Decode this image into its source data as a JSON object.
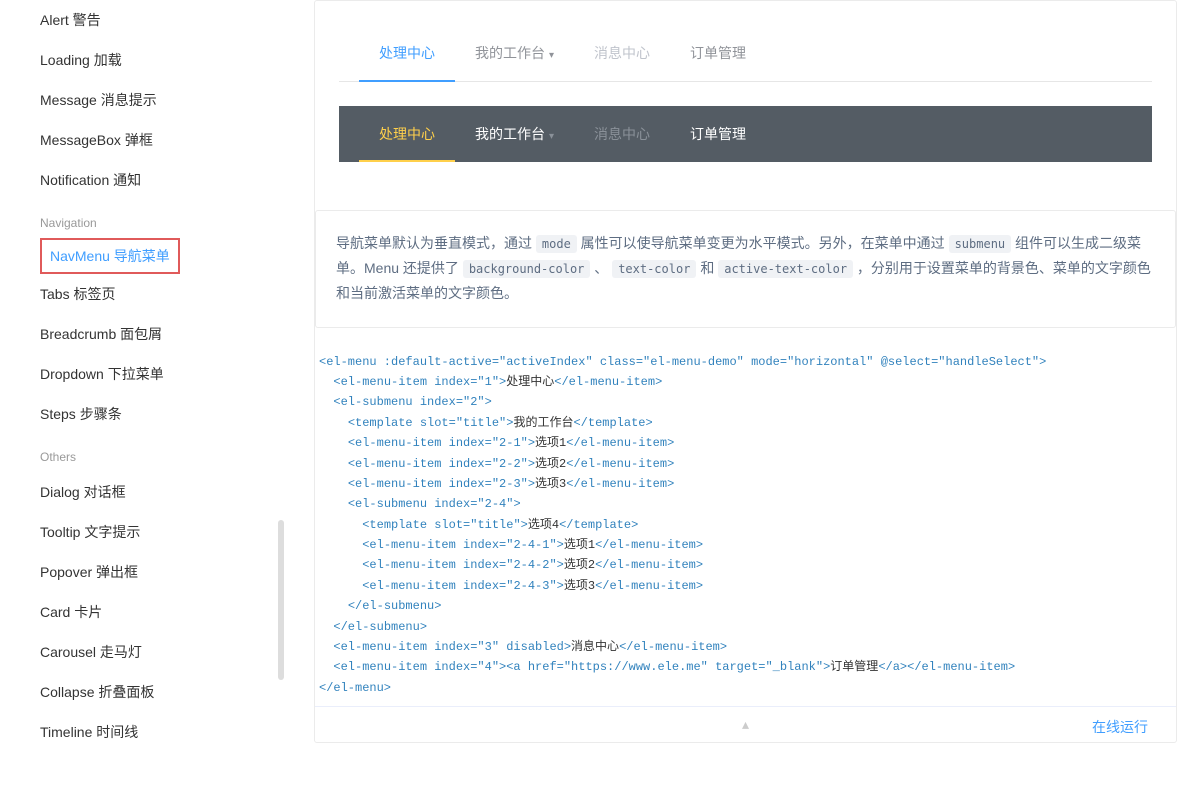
{
  "sidebar": {
    "items1": [
      "Alert 警告",
      "Loading 加载",
      "Message 消息提示",
      "MessageBox 弹框",
      "Notification 通知"
    ],
    "group_nav": "Navigation",
    "items2": [
      "NavMenu 导航菜单",
      "Tabs 标签页",
      "Breadcrumb 面包屑",
      "Dropdown 下拉菜单",
      "Steps 步骤条"
    ],
    "group_others": "Others",
    "items3": [
      "Dialog 对话框",
      "Tooltip 文字提示",
      "Popover 弹出框",
      "Card 卡片",
      "Carousel 走马灯",
      "Collapse 折叠面板",
      "Timeline 时间线"
    ]
  },
  "menu_demo": {
    "item1": "处理中心",
    "item2": "我的工作台",
    "item3": "消息中心",
    "item4": "订单管理"
  },
  "description": {
    "p1a": "导航菜单默认为垂直模式，通过 ",
    "c1": "mode",
    "p1b": " 属性可以使导航菜单变更为水平模式。另外，在菜单中通过 ",
    "c2": "submenu",
    "p1c": " 组件可以生成二级菜单。Menu 还提供了 ",
    "c3": "background-color",
    "sep1": " 、 ",
    "c4": "text-color",
    "p1d": " 和 ",
    "c5": "active-text-color",
    "p1e": " ，分别用于设置菜单的背景色、菜单的文字颜色和当前激活菜单的文字颜色。"
  },
  "footer": {
    "run": "在线运行"
  },
  "code": {
    "l1_open": "<el-menu :default-active=\"activeIndex\" class=\"el-menu-demo\" mode=\"horizontal\" @select=\"handleSelect\">",
    "l2_o": "<el-menu-item index=\"1\">",
    "l2_t": "处理中心",
    "l2_c": "</el-menu-item>",
    "l3": "<el-submenu index=\"2\">",
    "l4_o": "<template slot=\"title\">",
    "l4_t": "我的工作台",
    "l4_c": "</template>",
    "l5_o": "<el-menu-item index=\"2-1\">",
    "l5_t": "选项1",
    "l5_c": "</el-menu-item>",
    "l6_o": "<el-menu-item index=\"2-2\">",
    "l6_t": "选项2",
    "l6_c": "</el-menu-item>",
    "l7_o": "<el-menu-item index=\"2-3\">",
    "l7_t": "选项3",
    "l7_c": "</el-menu-item>",
    "l8": "<el-submenu index=\"2-4\">",
    "l9_o": "<template slot=\"title\">",
    "l9_t": "选项4",
    "l9_c": "</template>",
    "l10_o": "<el-menu-item index=\"2-4-1\">",
    "l10_t": "选项1",
    "l10_c": "</el-menu-item>",
    "l11_o": "<el-menu-item index=\"2-4-2\">",
    "l11_t": "选项2",
    "l11_c": "</el-menu-item>",
    "l12_o": "<el-menu-item index=\"2-4-3\">",
    "l12_t": "选项3",
    "l12_c": "</el-menu-item>",
    "l13": "</el-submenu>",
    "l14": "</el-submenu>",
    "l15_o": "<el-menu-item index=\"3\" disabled>",
    "l15_t": "消息中心",
    "l15_c": "</el-menu-item>",
    "l16_o": "<el-menu-item index=\"4\">",
    "l16_a": "<a href=\"https://www.ele.me\" target=\"_blank\">",
    "l16_t": "订单管理",
    "l16_ac": "</a>",
    "l16_c": "</el-menu-item>",
    "l17": "</el-menu>"
  }
}
